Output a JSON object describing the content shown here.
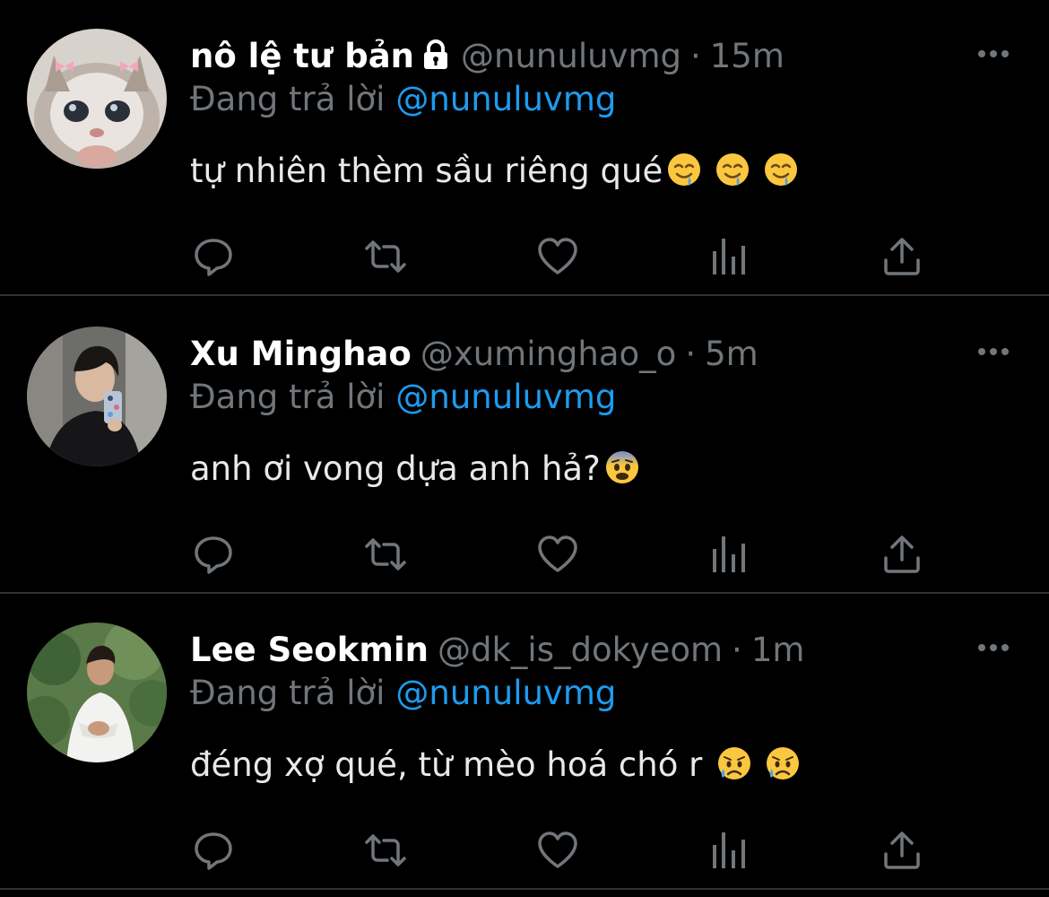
{
  "colors": {
    "background": "#000000",
    "divider": "#2f3336",
    "name": "#ffffff",
    "secondary": "#71767b",
    "link": "#1d9bf0",
    "text": "#e7e9ea"
  },
  "tweets": [
    {
      "name": "nô lệ tư bản",
      "protected": true,
      "handle": "@nunuluvmg",
      "separator": "·",
      "time": "15m",
      "replying_label": "Đang trả lời",
      "replying_to": "@nunuluvmg",
      "text": "tự nhiên thèm sầu riêng qué",
      "emojis": [
        "drooling-face",
        "drooling-face",
        "drooling-face"
      ],
      "avatar": "cat-with-bows-avatar"
    },
    {
      "name": "Xu Minghao",
      "protected": false,
      "handle": "@xuminghao_o",
      "separator": "·",
      "time": "5m",
      "replying_label": "Đang trả lời",
      "replying_to": "@nunuluvmg",
      "text": "anh ơi vong dựa anh hả?",
      "emojis": [
        "anxious-face"
      ],
      "avatar": "mirror-selfie-avatar"
    },
    {
      "name": "Lee Seokmin",
      "protected": false,
      "handle": "@dk_is_dokyeom",
      "separator": "·",
      "time": "1m",
      "replying_label": "Đang trả lời",
      "replying_to": "@nunuluvmg",
      "text": "đéng xợ qué, từ mèo hoá chó r",
      "emojis": [
        "sad-but-relieved-face",
        "sad-but-relieved-face"
      ],
      "avatar": "outdoor-portrait-avatar"
    }
  ],
  "action_icons": [
    "reply-icon",
    "retweet-icon",
    "like-icon",
    "analytics-icon",
    "share-icon"
  ]
}
